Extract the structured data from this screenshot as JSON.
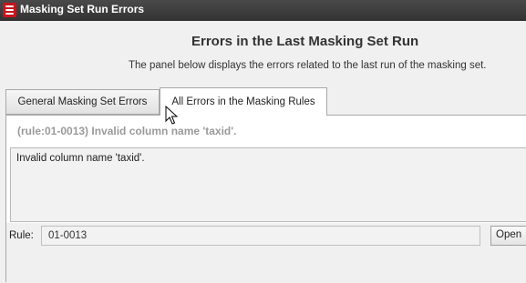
{
  "window": {
    "title": "Masking Set Run Errors",
    "icon": "database-icon"
  },
  "header": {
    "heading": "Errors in the Last Masking Set Run",
    "description": "The panel below displays the errors related to the last run of the masking set."
  },
  "tabs": [
    {
      "label": "General Masking Set Errors",
      "selected": false
    },
    {
      "label": "All Errors in the Masking Rules",
      "selected": true
    }
  ],
  "panel": {
    "rule_title": "(rule:01-0013) Invalid column name 'taxid'.",
    "error_text": "Invalid column name 'taxid'.",
    "rule_label": "Rule:",
    "rule_value": "01-0013",
    "open_label": "Open"
  },
  "colors": {
    "titlebar": "#3c3c3c",
    "icon_red": "#c8141c",
    "muted_title": "#9a9a9a"
  }
}
